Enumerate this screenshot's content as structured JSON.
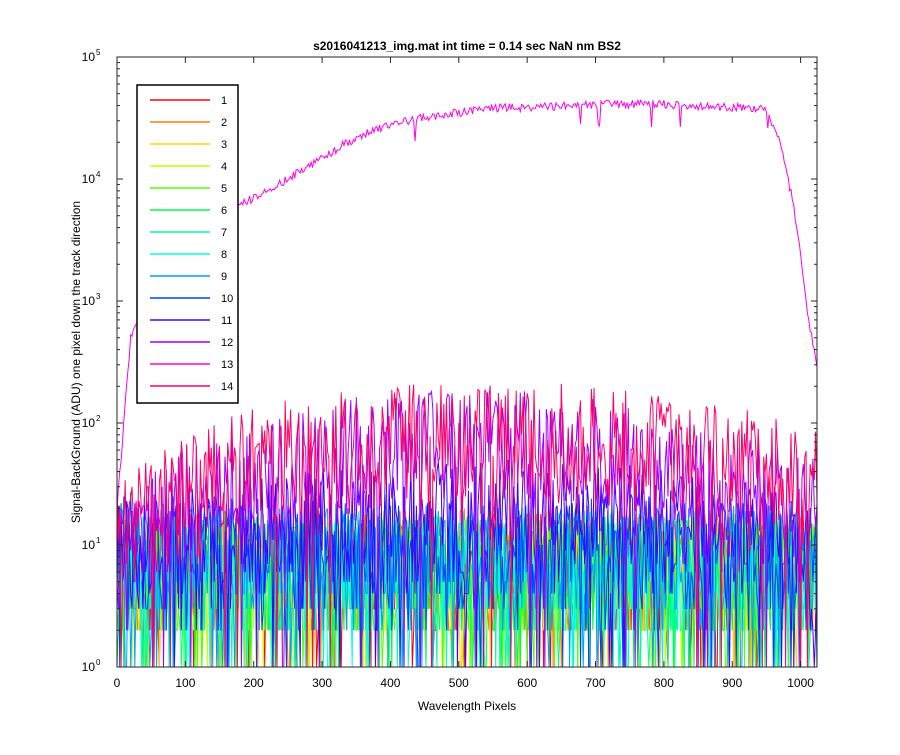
{
  "chart_data": {
    "type": "line",
    "title": "s2016041213_img.mat int time = 0.14 sec  NaN nm BS2",
    "xlabel": "Wavelength Pixels",
    "ylabel": "Signal-BackGround (ADU) one pixel down the track direction",
    "xlim": [
      0,
      1024
    ],
    "ylim": [
      1,
      100000
    ],
    "yscale": "log",
    "grid": false,
    "legend_position": "top-left",
    "x_ticks": [
      0,
      100,
      200,
      300,
      400,
      500,
      600,
      700,
      800,
      900,
      1000
    ],
    "y_ticks": [
      {
        "base": "10",
        "exp": "0",
        "value": 1
      },
      {
        "base": "10",
        "exp": "1",
        "value": 10
      },
      {
        "base": "10",
        "exp": "2",
        "value": 100
      },
      {
        "base": "10",
        "exp": "3",
        "value": 1000
      },
      {
        "base": "10",
        "exp": "4",
        "value": 10000
      },
      {
        "base": "10",
        "exp": "5",
        "value": 100000
      }
    ],
    "series": [
      {
        "name": "1",
        "color": "#ff0000",
        "noise": true,
        "x": [
          0,
          1024
        ],
        "y": [
          8,
          8
        ]
      },
      {
        "name": "2",
        "color": "#ff7f00",
        "noise": true,
        "x": [
          0,
          1024
        ],
        "y": [
          9,
          9
        ]
      },
      {
        "name": "3",
        "color": "#ffd400",
        "noise": true,
        "x": [
          0,
          1024
        ],
        "y": [
          9,
          9
        ]
      },
      {
        "name": "4",
        "color": "#bfff00",
        "noise": true,
        "x": [
          0,
          1024
        ],
        "y": [
          8,
          8
        ]
      },
      {
        "name": "5",
        "color": "#55ff00",
        "noise": true,
        "x": [
          0,
          1024
        ],
        "y": [
          8,
          8
        ]
      },
      {
        "name": "6",
        "color": "#00ff3f",
        "noise": true,
        "x": [
          0,
          1024
        ],
        "y": [
          8,
          8
        ]
      },
      {
        "name": "7",
        "color": "#00ff9f",
        "noise": true,
        "x": [
          0,
          1024
        ],
        "y": [
          8,
          8
        ]
      },
      {
        "name": "8",
        "color": "#00ffea",
        "noise": true,
        "x": [
          0,
          1024
        ],
        "y": [
          9,
          9
        ]
      },
      {
        "name": "9",
        "color": "#009fff",
        "noise": true,
        "x": [
          0,
          1024
        ],
        "y": [
          10,
          10
        ]
      },
      {
        "name": "10",
        "color": "#0040ff",
        "noise": true,
        "x": [
          0,
          1024
        ],
        "y": [
          12,
          12
        ]
      },
      {
        "name": "11",
        "color": "#3f00ff",
        "noise": true,
        "x": [
          0,
          100,
          200,
          300,
          400,
          500,
          600,
          700,
          800,
          900,
          1024
        ],
        "y": [
          10,
          14,
          17,
          20,
          22,
          23,
          22,
          21,
          19,
          16,
          12
        ]
      },
      {
        "name": "12",
        "color": "#9f00ff",
        "noise": true,
        "x": [
          0,
          50,
          100,
          200,
          300,
          400,
          500,
          600,
          700,
          800,
          900,
          1000,
          1024
        ],
        "y": [
          12,
          20,
          30,
          45,
          70,
          85,
          85,
          80,
          70,
          55,
          40,
          28,
          25
        ]
      },
      {
        "name": "13",
        "color": "#ff00ea",
        "noise": false,
        "x": [
          0,
          10,
          20,
          25,
          40,
          60,
          100,
          150,
          200,
          250,
          300,
          350,
          400,
          450,
          500,
          550,
          600,
          650,
          700,
          750,
          800,
          850,
          900,
          950,
          970,
          990,
          1000,
          1010,
          1024
        ],
        "y": [
          20,
          100,
          500,
          600,
          700,
          1200,
          2500,
          5000,
          7000,
          10000,
          15000,
          22000,
          28000,
          32000,
          35000,
          38000,
          39000,
          40000,
          41000,
          41000,
          41000,
          40000,
          39000,
          37000,
          20000,
          6000,
          2500,
          800,
          300
        ]
      },
      {
        "name": "14",
        "color": "#ff0066",
        "noise": true,
        "x": [
          0,
          50,
          100,
          200,
          300,
          400,
          500,
          600,
          700,
          800,
          900,
          1000,
          1024
        ],
        "y": [
          15,
          25,
          40,
          60,
          80,
          95,
          100,
          95,
          90,
          80,
          60,
          45,
          40
        ]
      }
    ]
  }
}
